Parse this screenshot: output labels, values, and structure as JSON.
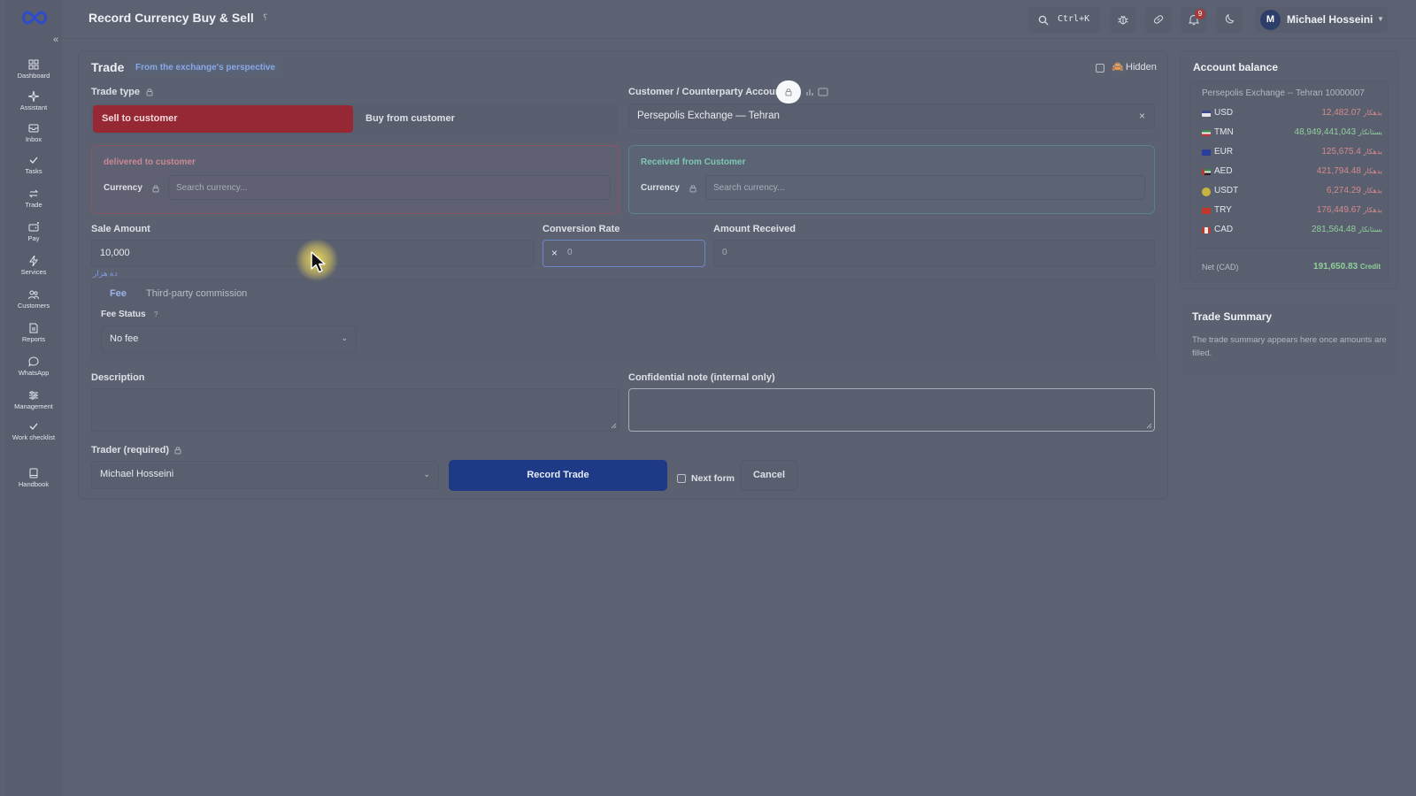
{
  "app": {
    "title": "Record Currency Buy & Sell",
    "title_mark": "؟"
  },
  "sidebar": {
    "items": [
      {
        "id": "dashboard",
        "label": "Dashboard",
        "icon": "dashboard-icon"
      },
      {
        "id": "assistant",
        "label": "Assistant",
        "icon": "sparkle-icon"
      },
      {
        "id": "inbox",
        "label": "Inbox",
        "icon": "inbox-icon"
      },
      {
        "id": "tasks",
        "label": "Tasks",
        "icon": "check-icon"
      },
      {
        "id": "trade",
        "label": "Trade",
        "icon": "exchange-icon"
      },
      {
        "id": "pay",
        "label": "Pay",
        "icon": "wallet-icon"
      },
      {
        "id": "services",
        "label": "Services",
        "icon": "bolt-icon"
      },
      {
        "id": "customers",
        "label": "Customers",
        "icon": "users-icon"
      },
      {
        "id": "reports",
        "label": "Reports",
        "icon": "report-icon"
      },
      {
        "id": "whatsapp",
        "label": "WhatsApp",
        "icon": "chat-icon"
      },
      {
        "id": "management",
        "label": "Management",
        "icon": "sliders-icon"
      },
      {
        "id": "work-checklist",
        "label": "Work checklist",
        "icon": "checklist-icon"
      },
      {
        "id": "handbook",
        "label": "Handbook",
        "icon": "book-icon"
      }
    ]
  },
  "topbar": {
    "search_shortcut": "Ctrl+K",
    "notification_count": "9",
    "user": {
      "initial": "M",
      "name": "Michael Hosseini"
    }
  },
  "trade": {
    "title": "Trade",
    "perspective_badge": "From the exchange's perspective",
    "hidden_label": "Hidden",
    "trade_type_label": "Trade type",
    "sell_label": "Sell to customer",
    "buy_label": "Buy from customer",
    "customer_label": "Customer / Counterparty Account",
    "customer_value": "Persepolis Exchange — Tehran",
    "delivered_title": "delivered to customer",
    "received_title": "Received from Customer",
    "currency_label": "Currency",
    "currency_placeholder": "Search currency...",
    "sale_amount_label": "Sale Amount",
    "sale_amount_value": "10,000",
    "sale_amount_words": "ده هزار",
    "conversion_rate_label": "Conversion Rate",
    "conversion_rate_prefix": "×",
    "conversion_rate_placeholder": "0",
    "amount_received_label": "Amount Received",
    "amount_received_placeholder": "0",
    "fee_tab": "Fee",
    "third_party_tab": "Third-party commission",
    "fee_status_label": "Fee Status",
    "fee_status_value": "No fee",
    "description_label": "Description",
    "confidential_label": "Confidential note (internal only)",
    "trader_label": "Trader (required)",
    "trader_value": "Michael Hosseini",
    "record_button": "Record Trade",
    "next_form_label": "Next form",
    "cancel_button": "Cancel"
  },
  "balance": {
    "title": "Account balance",
    "account": "Persepolis Exchange -- Tehran 10000007",
    "rows": [
      {
        "currency": "USD",
        "amount": "12,482.07",
        "unit": "بدهکار",
        "status": "debit"
      },
      {
        "currency": "TMN",
        "amount": "48,949,441,043",
        "unit": "بستانکار",
        "status": "credit"
      },
      {
        "currency": "EUR",
        "amount": "125,675.4",
        "unit": "بدهکار",
        "status": "debit"
      },
      {
        "currency": "AED",
        "amount": "421,794.48",
        "unit": "بدهکار",
        "status": "debit"
      },
      {
        "currency": "USDT",
        "amount": "6,274.29",
        "unit": "بدهکار",
        "status": "debit"
      },
      {
        "currency": "TRY",
        "amount": "176,449.67",
        "unit": "بدهکار",
        "status": "debit"
      },
      {
        "currency": "CAD",
        "amount": "281,564.48",
        "unit": "بستانکار",
        "status": "credit"
      }
    ],
    "net_label": "Net (CAD)",
    "net_value": "191,650.83",
    "net_unit": "Credit"
  },
  "summary": {
    "title": "Trade Summary",
    "text": "The trade summary appears here once amounts are filled."
  },
  "colors": {
    "sell_active": "#962834",
    "primary_button": "#1e3a86",
    "debit": "#d48a8a",
    "credit": "#8fcf9a"
  }
}
